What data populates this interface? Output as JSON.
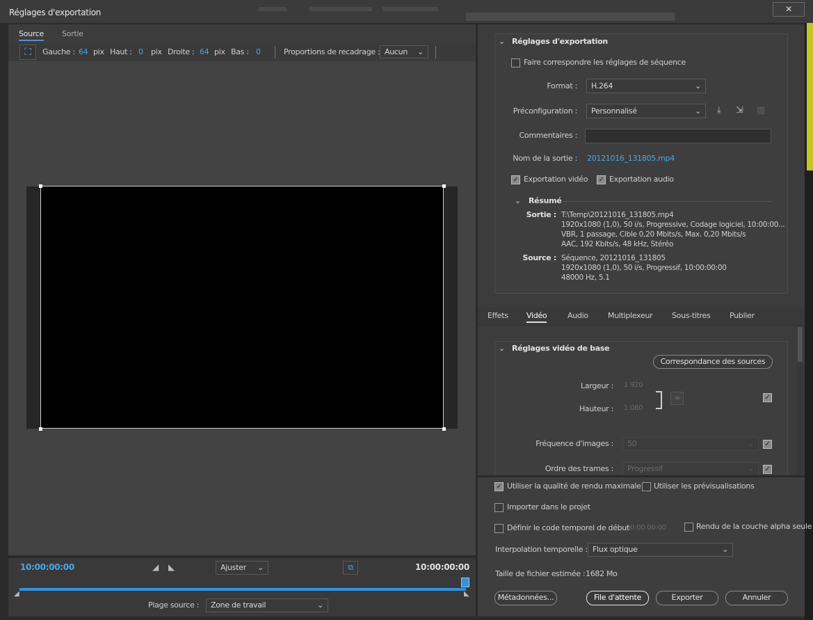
{
  "window": {
    "title": "Réglages d'exportation",
    "close_glyph": "✕"
  },
  "left": {
    "tabs": [
      "Source",
      "Sortie"
    ],
    "crop": {
      "left_label": "Gauche :",
      "left_value": "64",
      "unit": "pix",
      "top_label": "Haut :",
      "top_value": "0",
      "right_label": "Droite :",
      "right_value": "64",
      "bottom_label": "Bas :",
      "bottom_value": "0",
      "ratio_label": "Proportions de recadrage :",
      "ratio_value": "Aucun"
    },
    "timeline": {
      "start_tc": "10:00:00:00",
      "end_tc": "10:00:00:00",
      "zoom_value": "Ajuster",
      "source_range_label": "Plage source :",
      "source_range_value": "Zone de travail"
    }
  },
  "export": {
    "section_title": "Réglages d'exportation",
    "match_sequence_label": "Faire correspondre les réglages de séquence",
    "format_label": "Format :",
    "format_value": "H.264",
    "preset_label": "Préconfiguration :",
    "preset_value": "Personnalisé",
    "comments_label": "Commentaires :",
    "comments_value": "",
    "output_name_label": "Nom de la sortie :",
    "output_name_value": "20121016_131805.mp4",
    "export_video_label": "Exportation vidéo",
    "export_audio_label": "Exportation audio",
    "summary_title": "Résumé",
    "output_label": "Sortie :",
    "output_lines": [
      "T:\\Temp\\20121016_131805.mp4",
      "1920x1080 (1,0), 50 i/s, Progressive, Codage logiciel, 10:00:00...",
      "VBR, 1 passage, Cible 0,20  Mbits/s, Max. 0,20  Mbits/s",
      "AAC, 192  Kbits/s, 48  kHz, Stéréo"
    ],
    "source_label": "Source :",
    "source_lines": [
      "Séquence, 20121016_131805",
      "1920x1080 (1,0), 50  i/s, Progressif, 10:00:00:00",
      "48000 Hz, 5.1"
    ]
  },
  "tabs2": [
    "Effets",
    "Vidéo",
    "Audio",
    "Multiplexeur",
    "Sous-titres",
    "Publier"
  ],
  "video": {
    "section_title": "Réglages vidéo de base",
    "match_source_button": "Correspondance des sources",
    "width_label": "Largeur :",
    "width_value": "1 920",
    "height_label": "Hauteur :",
    "height_value": "1 080",
    "fps_label": "Fréquence d'images :",
    "fps_value": "50",
    "field_order_label": "Ordre des trames :",
    "field_order_value": "Progressif"
  },
  "bottom": {
    "max_quality_label": "Utiliser la qualité de rendu maximale",
    "use_previews_label": "Utiliser les prévisualisations",
    "import_label": "Importer dans le projet",
    "start_tc_label": "Définir le code temporel de début",
    "start_tc_value": "00:00:00:00",
    "alpha_label": "Rendu de la couche alpha seule",
    "interp_label": "Interpolation temporelle :",
    "interp_value": "Flux optique",
    "filesize_label": "Taille de fichier estimée :",
    "filesize_value": "1682 Mo",
    "metadata_button": "Métadonnées...",
    "queue_button": "File d'attente",
    "export_button": "Exporter",
    "cancel_button": "Annuler"
  }
}
